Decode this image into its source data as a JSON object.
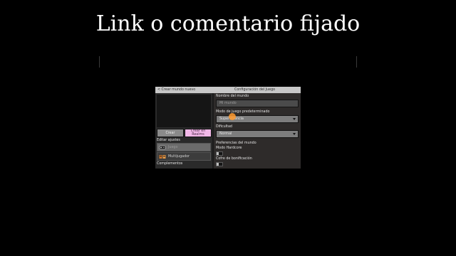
{
  "caption": "Link o comentario fijado",
  "screen": {
    "topbar": {
      "back_label": "< Crear mundo nuevo",
      "title": "Configuración del Juego"
    },
    "left": {
      "create_label": "Crear",
      "create_realm_label": "Crear en Realms",
      "edit_settings_label": "Editar ajustes",
      "items": [
        {
          "label": "Juego",
          "icon": "controller-icon",
          "selected": true
        },
        {
          "label": "Multijugador",
          "icon": "multiplayer-icon",
          "selected": false
        }
      ],
      "complements_label": "Complementos"
    },
    "right": {
      "world_name_label": "Nombre del mundo",
      "world_name_value": "Mi mundo",
      "game_mode_label": "Modo de juego predeterminado",
      "game_mode_value": "Supervivencia",
      "difficulty_label": "Dificultad",
      "difficulty_value": "Normal",
      "world_prefs_label": "Preferencias del mundo",
      "hardcore_label": "Modo Hardcore",
      "bonus_chest_label": "Cofre de bonificación"
    }
  },
  "colors": {
    "accent_pink": "#f2b8e8",
    "cursor_orange": "#ff9a2e"
  }
}
